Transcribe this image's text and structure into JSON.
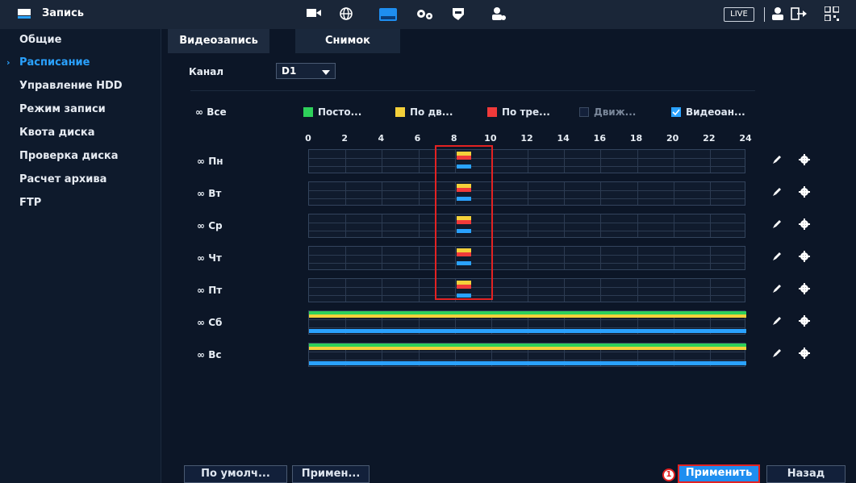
{
  "window": {
    "title": "Запись",
    "live_label": "LIVE"
  },
  "sidebar": {
    "items": [
      {
        "label": "Общие",
        "active": false
      },
      {
        "label": "Расписание",
        "active": true
      },
      {
        "label": "Управление HDD",
        "active": false
      },
      {
        "label": "Режим записи",
        "active": false
      },
      {
        "label": "Квота диска",
        "active": false
      },
      {
        "label": "Проверка диска",
        "active": false
      },
      {
        "label": "Расчет архива",
        "active": false
      },
      {
        "label": "FTP",
        "active": false
      }
    ]
  },
  "tabs": [
    {
      "label": "Видеозапись",
      "active": true
    },
    {
      "label": "Снимок",
      "active": false
    }
  ],
  "channel": {
    "label": "Канал",
    "value": "D1"
  },
  "all_label": "Все",
  "legend": [
    {
      "label": "Посто...",
      "color": "#2ed05a",
      "checked": true
    },
    {
      "label": "По дв...",
      "color": "#f4d03a",
      "checked": true
    },
    {
      "label": "По тре...",
      "color": "#f03a3a",
      "checked": true
    },
    {
      "label": "Движ...",
      "color": "#1a2a44",
      "checked": false
    },
    {
      "label": "Видеоан...",
      "color": "#2aa2ff",
      "checked": true
    }
  ],
  "hours": [
    "0",
    "2",
    "4",
    "6",
    "8",
    "10",
    "12",
    "14",
    "16",
    "18",
    "20",
    "22",
    "24"
  ],
  "days": [
    {
      "label": "Пн",
      "full": false,
      "partial_hours": [
        8,
        9
      ]
    },
    {
      "label": "Вт",
      "full": false,
      "partial_hours": [
        8,
        9
      ]
    },
    {
      "label": "Ср",
      "full": false,
      "partial_hours": [
        8,
        9
      ]
    },
    {
      "label": "Чт",
      "full": false,
      "partial_hours": [
        8,
        9
      ]
    },
    {
      "label": "Пт",
      "full": false,
      "partial_hours": [
        8,
        9
      ]
    },
    {
      "label": "Сб",
      "full": true
    },
    {
      "label": "Вс",
      "full": true
    }
  ],
  "buttons": {
    "default": "По умолч...",
    "apply_to": "Примен...",
    "apply": "Применить",
    "back": "Назад"
  },
  "callout_number": "1",
  "colors": {
    "accent": "#2aa2ff",
    "continuous": "#2ed05a",
    "motion": "#f4d03a",
    "alarm": "#f03a3a",
    "analytics": "#2aa2ff",
    "highlight": "#e32222"
  },
  "icons": {
    "camera": "camera-icon",
    "network": "network-icon",
    "storage": "storage-icon",
    "settings": "settings-icon",
    "shield": "shield-icon",
    "account": "account-icon",
    "user": "user-icon",
    "logout": "logout-icon",
    "qr": "qr-icon"
  }
}
